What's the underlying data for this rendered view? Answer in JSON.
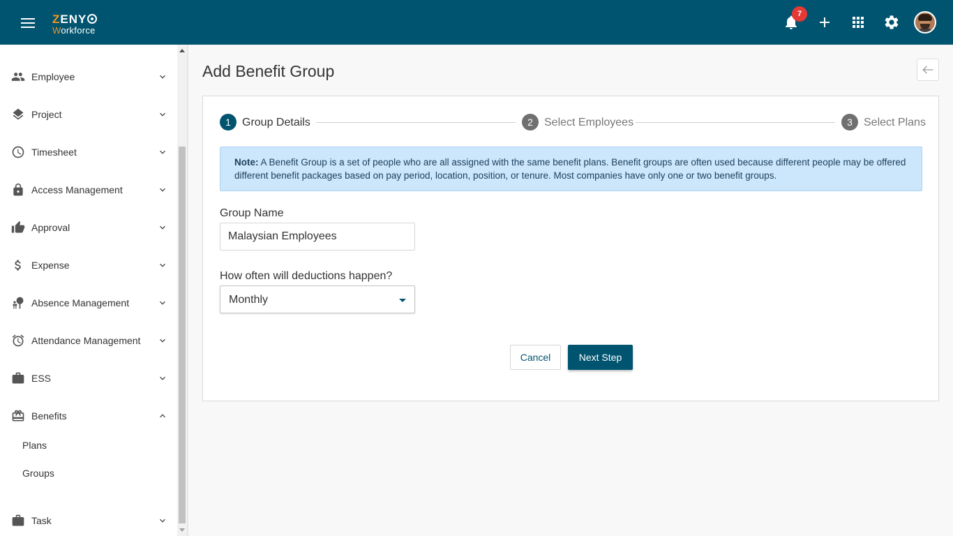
{
  "app": {
    "logo_top": "ZENY",
    "logo_bottom": "orkforce",
    "logo_bottom_accent": "W"
  },
  "header": {
    "notification_count": "7",
    "icons": [
      "menu-icon",
      "bell-icon",
      "plus-icon",
      "apps-grid-icon",
      "gear-icon",
      "avatar"
    ]
  },
  "sidebar": {
    "items": [
      {
        "label": "Employee",
        "icon": "people-icon"
      },
      {
        "label": "Project",
        "icon": "layers-icon"
      },
      {
        "label": "Timesheet",
        "icon": "clock-icon"
      },
      {
        "label": "Access Management",
        "icon": "lock-icon"
      },
      {
        "label": "Approval",
        "icon": "thumbs-up-icon"
      },
      {
        "label": "Expense",
        "icon": "dollar-icon"
      },
      {
        "label": "Absence Management",
        "icon": "beach-icon"
      },
      {
        "label": "Attendance Management",
        "icon": "alarm-icon"
      },
      {
        "label": "ESS",
        "icon": "briefcase-icon"
      },
      {
        "label": "Benefits",
        "icon": "gift-card-icon",
        "expanded": true
      },
      {
        "label": "Task",
        "icon": "briefcase-icon"
      }
    ],
    "benefits_sub": [
      "Plans",
      "Groups"
    ]
  },
  "page": {
    "title": "Add Benefit Group",
    "steps": [
      {
        "num": "1",
        "label": "Group Details",
        "active": true
      },
      {
        "num": "2",
        "label": "Select Employees",
        "active": false
      },
      {
        "num": "3",
        "label": "Select Plans",
        "active": false
      }
    ],
    "note": {
      "bold": "Note:",
      "text": " A Benefit Group is a set of people who are all assigned with the same benefit plans. Benefit groups are often used because different people may be offered different benefit packages based on pay period, location, position, or tenure. Most companies have only one or two benefit groups."
    },
    "group_name": {
      "label": "Group Name",
      "value": "Malaysian Employees"
    },
    "deductions": {
      "label": "How often will deductions happen?",
      "value": "Monthly"
    },
    "buttons": {
      "cancel": "Cancel",
      "next": "Next Step"
    }
  },
  "colors": {
    "primary": "#015470",
    "accent": "#f7941d",
    "note_bg": "#cce6fb",
    "badge": "#e53935",
    "step_inactive": "#6b6b6b"
  }
}
